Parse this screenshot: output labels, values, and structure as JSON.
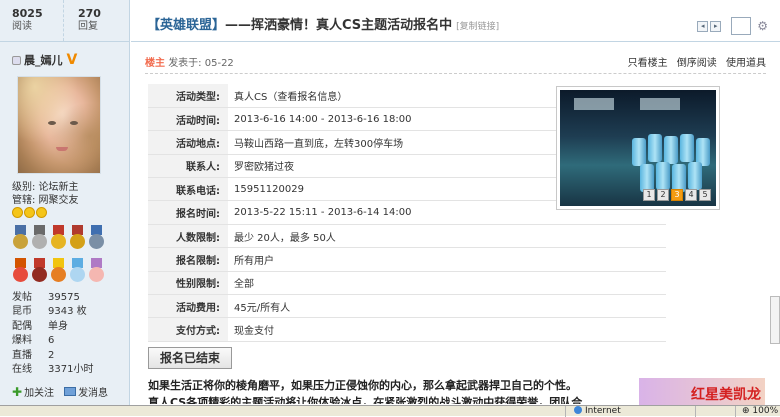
{
  "post_stats": {
    "views": "8025",
    "views_label": "阅读",
    "replies": "270",
    "replies_label": "回复"
  },
  "author": {
    "name": "晨_嫣儿",
    "level": "级别: 论坛新主",
    "honor": "管辖: 网聚交友",
    "profile": [
      {
        "k": "发帖",
        "v": "39575"
      },
      {
        "k": "昆币",
        "v": "9343 枚"
      },
      {
        "k": "配偶",
        "v": "单身"
      },
      {
        "k": "爆料",
        "v": "6"
      },
      {
        "k": "直播",
        "v": "2"
      },
      {
        "k": "在线",
        "v": "3371小时"
      }
    ],
    "follow_label": "加关注",
    "message_label": "发消息"
  },
  "thread": {
    "category": "【英雄联盟】",
    "title": "——挥洒豪情！真人CS主题活动报名中",
    "copy_link": "[复制链接]"
  },
  "post_meta": {
    "host_label": "楼主",
    "posted": "发表于: 05-22",
    "only_host": "只看楼主",
    "reverse": "倒序阅读",
    "tools": "使用道具"
  },
  "activity": [
    {
      "k": "活动类型:",
      "v": "真人CS（查看报名信息）"
    },
    {
      "k": "活动时间:",
      "v": "2013-6-16 14:00 - 2013-6-16 18:00"
    },
    {
      "k": "活动地点:",
      "v": "马鞍山西路一直到底，左转300停车场"
    },
    {
      "k": "联系人:",
      "v": "罗密欧猪过夜"
    },
    {
      "k": "联系电话:",
      "v": "15951120029"
    },
    {
      "k": "报名时间:",
      "v": "2013-5-22 15:11 - 2013-6-14 14:00"
    },
    {
      "k": "人数限制:",
      "v": "最少 20人，最多 50人"
    },
    {
      "k": "报名限制:",
      "v": "所有用户"
    },
    {
      "k": "性别限制:",
      "v": "全部"
    },
    {
      "k": "活动费用:",
      "v": "45元/所有人"
    },
    {
      "k": "支付方式:",
      "v": "现金支付"
    }
  ],
  "gallery": {
    "pages": [
      "1",
      "2",
      "3",
      "4",
      "5"
    ],
    "active": "3"
  },
  "signup_closed_label": "报名已结束",
  "body": {
    "line1": "如果生活正将你的棱角磨平，如果压力正侵蚀你的内心，那么拿起武器捍卫自己的个性。",
    "line2": "真人CS各项精彩的主题活动将让你体验冰点，在紧张激烈的战斗激动中获得荣誉，团队合"
  },
  "ad": {
    "text": "红星美凯龙"
  },
  "statusbar": {
    "zone": "Internet",
    "zoom": "100%"
  }
}
